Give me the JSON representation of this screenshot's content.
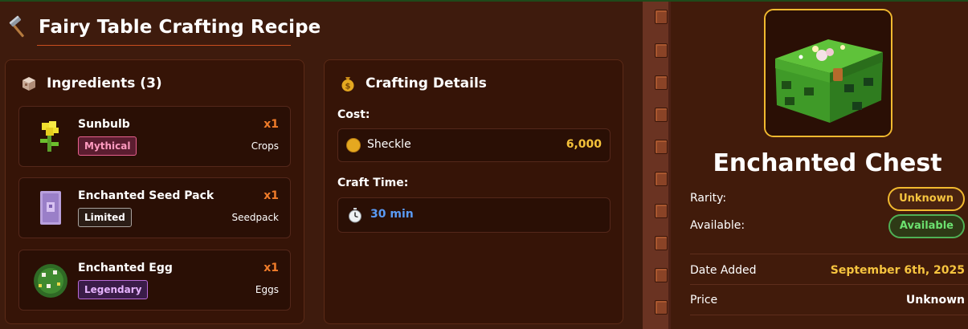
{
  "header": {
    "icon": "hammer-icon",
    "title": "Fairy Table Crafting Recipe"
  },
  "ingredients": {
    "heading": "Ingredients (3)",
    "icon": "crate-icon",
    "items": [
      {
        "name": "Sunbulb",
        "quantity": "x1",
        "rarity": "Mythical",
        "category": "Crops",
        "icon": "sunbulb-icon"
      },
      {
        "name": "Enchanted Seed Pack",
        "quantity": "x1",
        "rarity": "Limited",
        "category": "Seedpack",
        "icon": "seed-pack-icon"
      },
      {
        "name": "Enchanted Egg",
        "quantity": "x1",
        "rarity": "Legendary",
        "category": "Eggs",
        "icon": "egg-icon"
      }
    ]
  },
  "details": {
    "heading": "Crafting Details",
    "icon": "money-bag-icon",
    "cost_label": "Cost:",
    "currency": "Sheckle",
    "cost_value": "6,000",
    "time_label": "Craft Time:",
    "time_value": "30 min"
  },
  "item": {
    "name": "Enchanted Chest",
    "icon": "enchanted-chest-icon",
    "rarity_label": "Rarity:",
    "rarity_value": "Unknown",
    "available_label": "Available:",
    "available_value": "Available",
    "date_label": "Date Added",
    "date_value": "September 6th, 2025",
    "price_label": "Price",
    "price_value": "Unknown"
  },
  "colors": {
    "background": "#3e1b0d",
    "accent_orange": "#f07c2a",
    "gold": "#f1b92f",
    "mythical": "#e8608e",
    "legendary": "#b86ad8",
    "available": "#4fb055",
    "time_blue": "#5a9bf6"
  }
}
